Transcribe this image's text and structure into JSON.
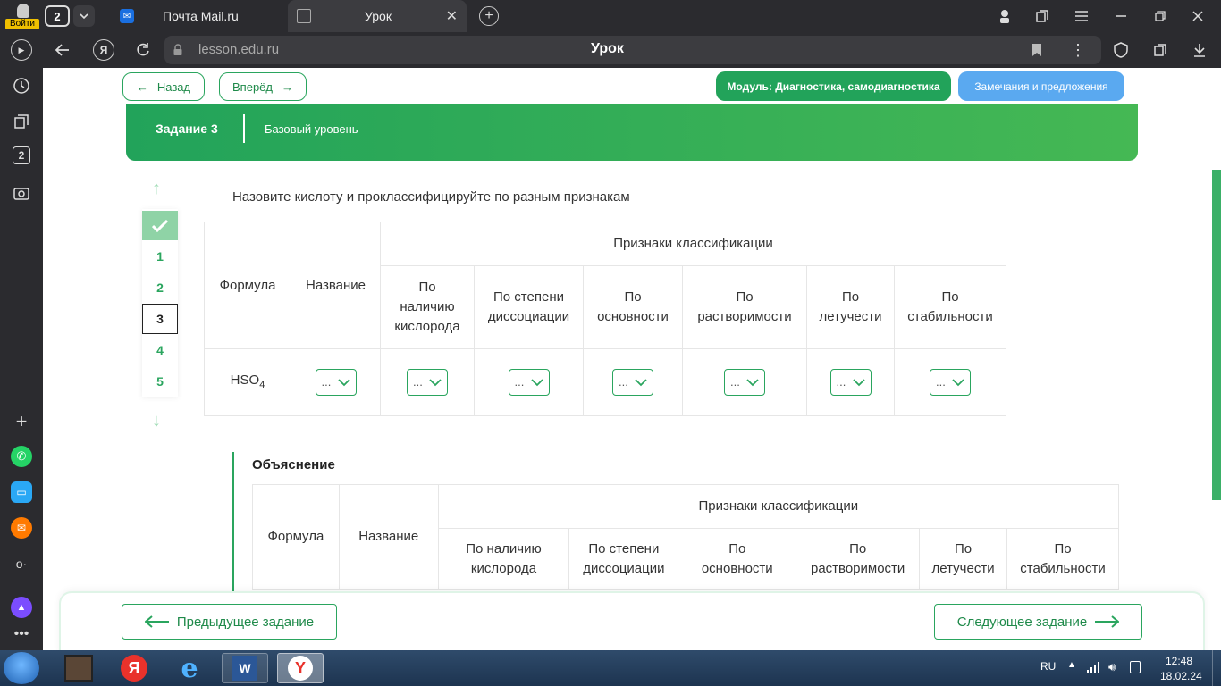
{
  "browser": {
    "login_label": "Войти",
    "tab_count": "2",
    "tabs": [
      {
        "title": "Почта Mail.ru"
      },
      {
        "title": "Урок"
      }
    ],
    "url": "lesson.edu.ru",
    "page_title": "Урок",
    "sidebar_badge": "2"
  },
  "header": {
    "back_label": "Назад",
    "forward_label": "Вперёд",
    "module_label": "Модуль: Диагностика, самодиагностика",
    "feedback_label": "Замечания и предложения"
  },
  "task": {
    "number_label": "Задание 3",
    "level_label": "Базовый уровень",
    "question": "Назовите кислоту и проклассифицируйте по разным признакам",
    "nav_items": [
      "1",
      "2",
      "3",
      "4",
      "5"
    ]
  },
  "table": {
    "col_formula": "Формула",
    "col_name": "Название",
    "group_header": "Признаки классификации",
    "sub_headers": [
      "По наличию кислорода",
      "По степени диссоциации",
      "По основности",
      "По растворимости",
      "По летучести",
      "По стабильности"
    ],
    "formula_main": "HSO",
    "formula_sub": "4",
    "dropdown_value": "..."
  },
  "explanation": {
    "title": "Объяснение",
    "col_formula": "Формула",
    "col_name": "Название",
    "group_header": "Признаки классификации",
    "sub_headers": [
      "По наличию кислорода",
      "По степени диссоциации",
      "По основности",
      "По растворимости",
      "По летучести",
      "По стабильности"
    ]
  },
  "footer": {
    "prev_label": "Предыдущее задание",
    "next_label": "Следующее задание"
  },
  "taskbar": {
    "lang": "RU",
    "time": "12:48",
    "date": "18.02.24"
  },
  "colors": {
    "accent": "#2aa55e",
    "banner_start": "#22a35a",
    "banner_end": "#45b854",
    "feedback": "#5aa9f0",
    "chrome": "#2b2b2f"
  }
}
